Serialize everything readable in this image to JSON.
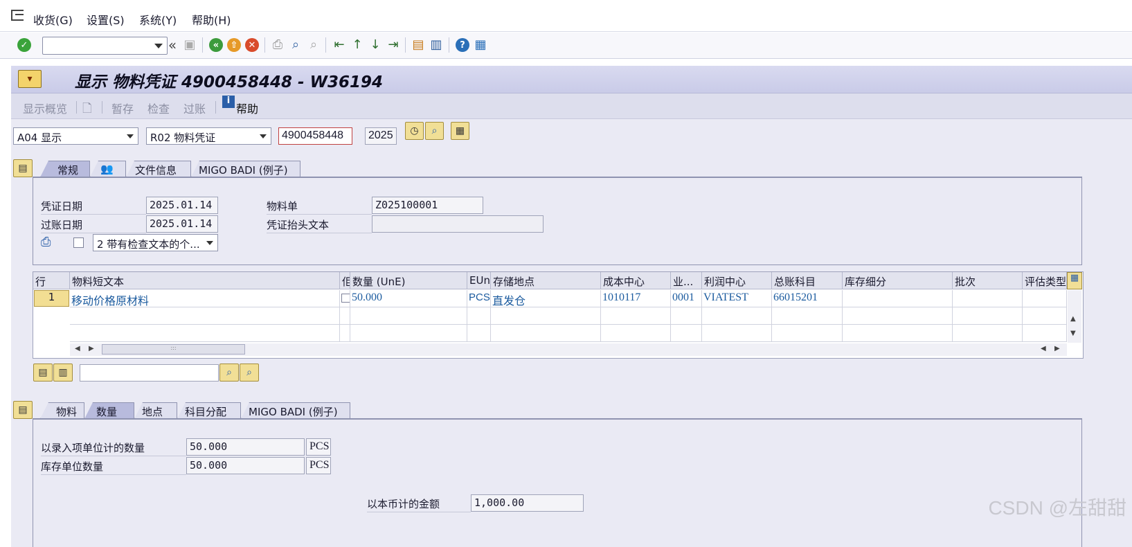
{
  "menu": {
    "items": [
      "收货(G)",
      "设置(S)",
      "系统(Y)",
      "帮助(H)"
    ]
  },
  "toolbar": {
    "command_field_value": "",
    "icons": [
      "enter-check-icon",
      "back-icon",
      "save-icon",
      "back-green-icon",
      "exit-icon",
      "cancel-icon",
      "print-icon",
      "find-icon",
      "find-next-icon",
      "first-page-icon",
      "prev-page-icon",
      "next-page-icon",
      "last-page-icon",
      "create-session-icon",
      "shortcut-icon",
      "help-icon",
      "customize-layout-icon"
    ]
  },
  "title": "显示 物料凭证 4900458448 - W36194",
  "appbar": {
    "show_overview": "显示概览",
    "hold": "暂存",
    "check": "检查",
    "post": "过账",
    "help": "帮助"
  },
  "selection": {
    "action": "A04 显示",
    "reference": "R02 物料凭证",
    "document_number": "4900458448",
    "year": "2025"
  },
  "header_tabs": [
    "常规",
    "",
    "文件信息",
    "MIGO BADI (例子)"
  ],
  "header": {
    "doc_date_label": "凭证日期",
    "doc_date": "2025.01.14",
    "posting_date_label": "过账日期",
    "posting_date": "2025.01.14",
    "bill_label": "物料单",
    "bill_value": "Z025100001",
    "header_text_label": "凭证抬头文本",
    "header_text_value": "",
    "print_option": "2 带有检查文本的个..."
  },
  "items_table": {
    "columns": [
      "行",
      "物料短文本",
      "佢",
      "数量 (UnE)",
      "EUn",
      "存储地点",
      "成本中心",
      "业...",
      "利润中心",
      "总账科目",
      "库存细分",
      "批次",
      "评估类型"
    ],
    "rows": [
      [
        "1",
        "移动价格原材料",
        "",
        "50.000",
        "PCS",
        "直发仓",
        "1010117",
        "0001",
        "VIATEST",
        "66015201",
        "",
        "",
        ""
      ]
    ]
  },
  "detail_tabs": [
    "物料",
    "数量",
    "地点",
    "科目分配",
    "MIGO BADI (例子)"
  ],
  "quantity": {
    "entry_qty_label": "以录入项单位计的数量",
    "entry_qty": "50.000",
    "entry_unit": "PCS",
    "stock_qty_label": "库存单位数量",
    "stock_qty": "50.000",
    "stock_unit": "PCS",
    "amount_label": "以本币计的金额",
    "amount": "1,000.00"
  },
  "watermark": "CSDN @左甜甜"
}
